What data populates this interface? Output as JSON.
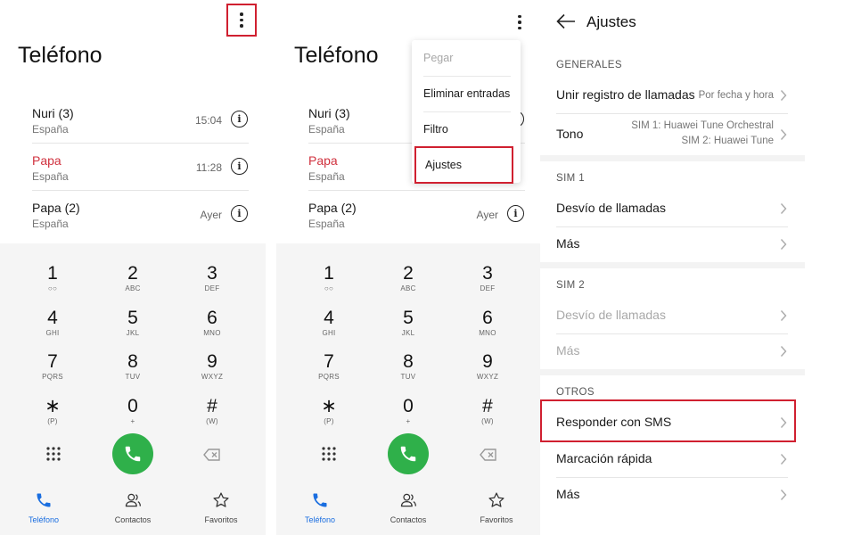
{
  "dialer": {
    "title": "Teléfono",
    "calls": [
      {
        "name": "Nuri (3)",
        "country": "España",
        "time": "15:04",
        "missed": false
      },
      {
        "name": "Papa",
        "country": "España",
        "time": "11:28",
        "missed": true
      },
      {
        "name": "Papa (2)",
        "country": "España",
        "time": "Ayer",
        "missed": false
      }
    ],
    "keys": [
      {
        "digit": "1",
        "sub": "voicemail"
      },
      {
        "digit": "2",
        "sub": "ABC"
      },
      {
        "digit": "3",
        "sub": "DEF"
      },
      {
        "digit": "4",
        "sub": "GHI"
      },
      {
        "digit": "5",
        "sub": "JKL"
      },
      {
        "digit": "6",
        "sub": "MNO"
      },
      {
        "digit": "7",
        "sub": "PQRS"
      },
      {
        "digit": "8",
        "sub": "TUV"
      },
      {
        "digit": "9",
        "sub": "WXYZ"
      },
      {
        "digit": "∗",
        "sub": "(P)"
      },
      {
        "digit": "0",
        "sub": "+"
      },
      {
        "digit": "#",
        "sub": "(W)"
      }
    ],
    "nav": {
      "phone": "Teléfono",
      "contacts": "Contactos",
      "favorites": "Favoritos"
    },
    "menu": {
      "paste": "Pegar",
      "delete_entries": "Eliminar entradas",
      "filter": "Filtro",
      "settings": "Ajustes"
    }
  },
  "settings": {
    "title": "Ajustes",
    "sections": {
      "general": "GENERALES",
      "sim1": "SIM 1",
      "sim2": "SIM 2",
      "others": "OTROS"
    },
    "merge_log": {
      "label": "Unir registro de llamadas",
      "value": "Por fecha y hora"
    },
    "ringtone": {
      "label": "Tono",
      "sim1": "SIM 1: Huawei Tune Orchestral",
      "sim2": "SIM 2: Huawei Tune"
    },
    "sim1_forward": "Desvío de llamadas",
    "sim1_more": "Más",
    "sim2_forward": "Desvío de llamadas",
    "sim2_more": "Más",
    "reply_sms": "Responder con SMS",
    "speed_dial": "Marcación rápida",
    "more": "Más"
  },
  "colors": {
    "accent": "#1a6ee0",
    "call_green": "#2fb04a",
    "missed_red": "#d0313e",
    "highlight_red": "#d02030"
  }
}
